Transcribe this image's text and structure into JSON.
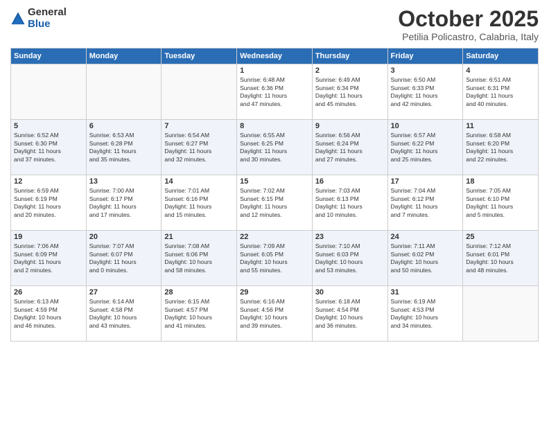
{
  "header": {
    "logo_general": "General",
    "logo_blue": "Blue",
    "month_title": "October 2025",
    "location": "Petilia Policastro, Calabria, Italy"
  },
  "days_of_week": [
    "Sunday",
    "Monday",
    "Tuesday",
    "Wednesday",
    "Thursday",
    "Friday",
    "Saturday"
  ],
  "weeks": [
    [
      {
        "day": "",
        "info": ""
      },
      {
        "day": "",
        "info": ""
      },
      {
        "day": "",
        "info": ""
      },
      {
        "day": "1",
        "info": "Sunrise: 6:48 AM\nSunset: 6:36 PM\nDaylight: 11 hours\nand 47 minutes."
      },
      {
        "day": "2",
        "info": "Sunrise: 6:49 AM\nSunset: 6:34 PM\nDaylight: 11 hours\nand 45 minutes."
      },
      {
        "day": "3",
        "info": "Sunrise: 6:50 AM\nSunset: 6:33 PM\nDaylight: 11 hours\nand 42 minutes."
      },
      {
        "day": "4",
        "info": "Sunrise: 6:51 AM\nSunset: 6:31 PM\nDaylight: 11 hours\nand 40 minutes."
      }
    ],
    [
      {
        "day": "5",
        "info": "Sunrise: 6:52 AM\nSunset: 6:30 PM\nDaylight: 11 hours\nand 37 minutes."
      },
      {
        "day": "6",
        "info": "Sunrise: 6:53 AM\nSunset: 6:28 PM\nDaylight: 11 hours\nand 35 minutes."
      },
      {
        "day": "7",
        "info": "Sunrise: 6:54 AM\nSunset: 6:27 PM\nDaylight: 11 hours\nand 32 minutes."
      },
      {
        "day": "8",
        "info": "Sunrise: 6:55 AM\nSunset: 6:25 PM\nDaylight: 11 hours\nand 30 minutes."
      },
      {
        "day": "9",
        "info": "Sunrise: 6:56 AM\nSunset: 6:24 PM\nDaylight: 11 hours\nand 27 minutes."
      },
      {
        "day": "10",
        "info": "Sunrise: 6:57 AM\nSunset: 6:22 PM\nDaylight: 11 hours\nand 25 minutes."
      },
      {
        "day": "11",
        "info": "Sunrise: 6:58 AM\nSunset: 6:20 PM\nDaylight: 11 hours\nand 22 minutes."
      }
    ],
    [
      {
        "day": "12",
        "info": "Sunrise: 6:59 AM\nSunset: 6:19 PM\nDaylight: 11 hours\nand 20 minutes."
      },
      {
        "day": "13",
        "info": "Sunrise: 7:00 AM\nSunset: 6:17 PM\nDaylight: 11 hours\nand 17 minutes."
      },
      {
        "day": "14",
        "info": "Sunrise: 7:01 AM\nSunset: 6:16 PM\nDaylight: 11 hours\nand 15 minutes."
      },
      {
        "day": "15",
        "info": "Sunrise: 7:02 AM\nSunset: 6:15 PM\nDaylight: 11 hours\nand 12 minutes."
      },
      {
        "day": "16",
        "info": "Sunrise: 7:03 AM\nSunset: 6:13 PM\nDaylight: 11 hours\nand 10 minutes."
      },
      {
        "day": "17",
        "info": "Sunrise: 7:04 AM\nSunset: 6:12 PM\nDaylight: 11 hours\nand 7 minutes."
      },
      {
        "day": "18",
        "info": "Sunrise: 7:05 AM\nSunset: 6:10 PM\nDaylight: 11 hours\nand 5 minutes."
      }
    ],
    [
      {
        "day": "19",
        "info": "Sunrise: 7:06 AM\nSunset: 6:09 PM\nDaylight: 11 hours\nand 2 minutes."
      },
      {
        "day": "20",
        "info": "Sunrise: 7:07 AM\nSunset: 6:07 PM\nDaylight: 11 hours\nand 0 minutes."
      },
      {
        "day": "21",
        "info": "Sunrise: 7:08 AM\nSunset: 6:06 PM\nDaylight: 10 hours\nand 58 minutes."
      },
      {
        "day": "22",
        "info": "Sunrise: 7:09 AM\nSunset: 6:05 PM\nDaylight: 10 hours\nand 55 minutes."
      },
      {
        "day": "23",
        "info": "Sunrise: 7:10 AM\nSunset: 6:03 PM\nDaylight: 10 hours\nand 53 minutes."
      },
      {
        "day": "24",
        "info": "Sunrise: 7:11 AM\nSunset: 6:02 PM\nDaylight: 10 hours\nand 50 minutes."
      },
      {
        "day": "25",
        "info": "Sunrise: 7:12 AM\nSunset: 6:01 PM\nDaylight: 10 hours\nand 48 minutes."
      }
    ],
    [
      {
        "day": "26",
        "info": "Sunrise: 6:13 AM\nSunset: 4:59 PM\nDaylight: 10 hours\nand 46 minutes."
      },
      {
        "day": "27",
        "info": "Sunrise: 6:14 AM\nSunset: 4:58 PM\nDaylight: 10 hours\nand 43 minutes."
      },
      {
        "day": "28",
        "info": "Sunrise: 6:15 AM\nSunset: 4:57 PM\nDaylight: 10 hours\nand 41 minutes."
      },
      {
        "day": "29",
        "info": "Sunrise: 6:16 AM\nSunset: 4:56 PM\nDaylight: 10 hours\nand 39 minutes."
      },
      {
        "day": "30",
        "info": "Sunrise: 6:18 AM\nSunset: 4:54 PM\nDaylight: 10 hours\nand 36 minutes."
      },
      {
        "day": "31",
        "info": "Sunrise: 6:19 AM\nSunset: 4:53 PM\nDaylight: 10 hours\nand 34 minutes."
      },
      {
        "day": "",
        "info": ""
      }
    ]
  ]
}
